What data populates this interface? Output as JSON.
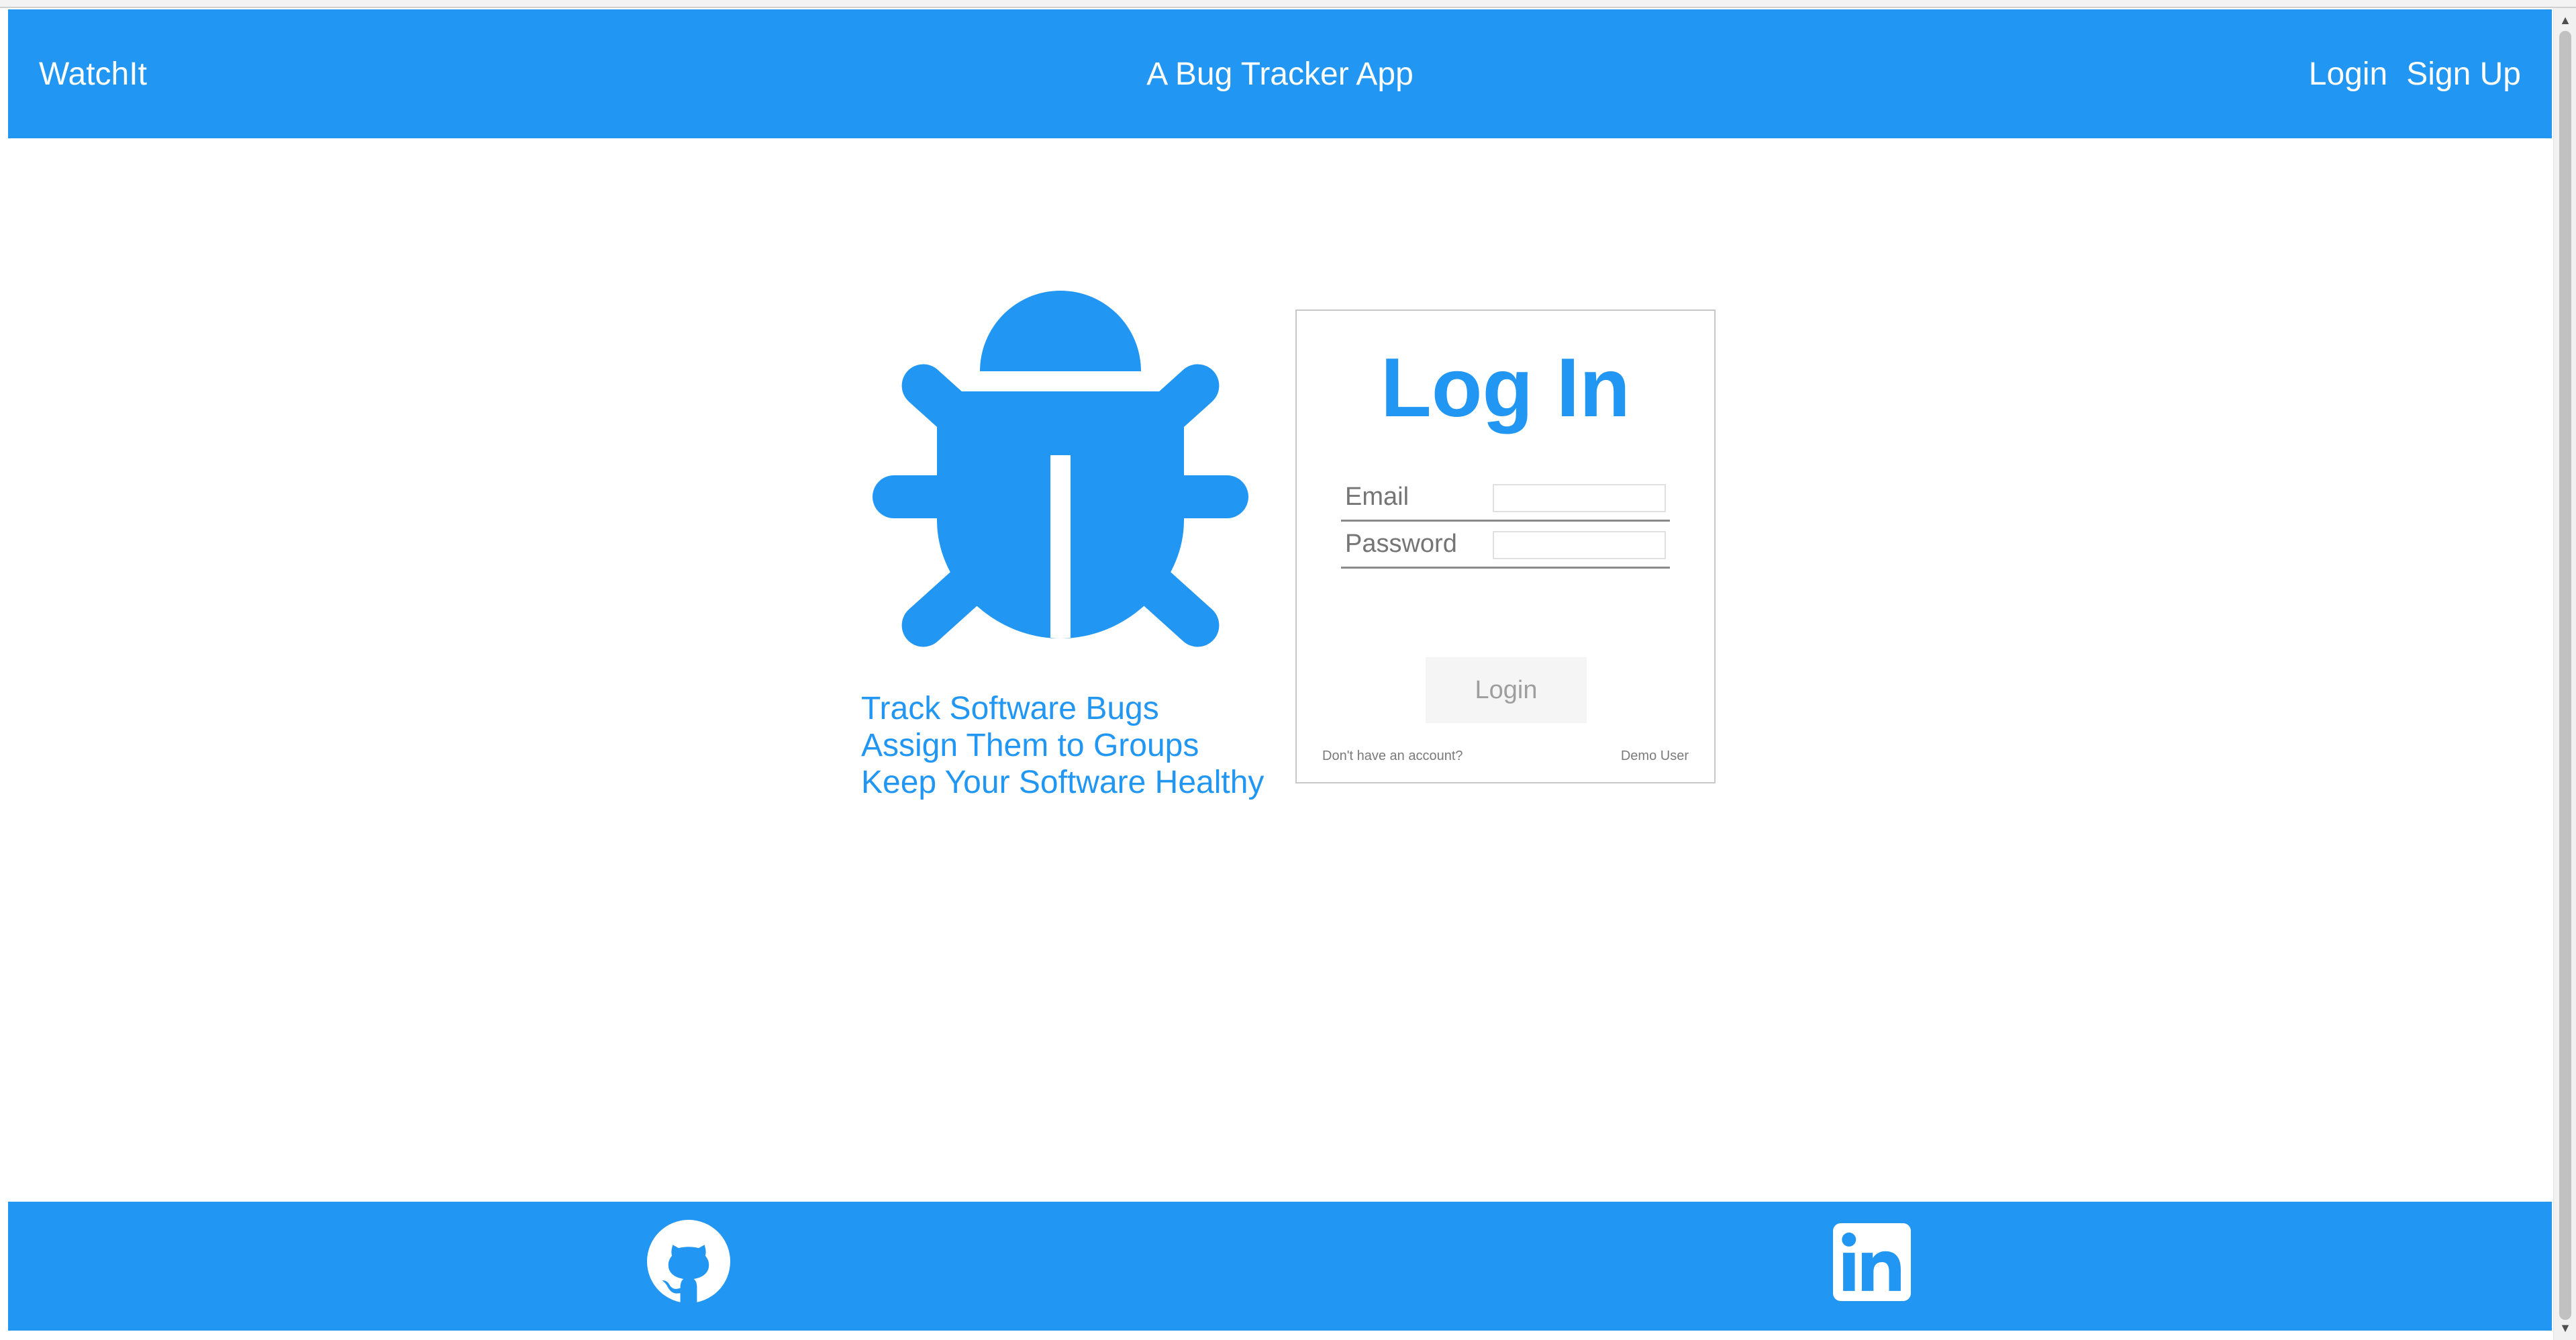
{
  "navbar": {
    "brand": "WatchIt",
    "subtitle": "A Bug Tracker App",
    "links": [
      "Login",
      "Sign Up"
    ]
  },
  "hero": {
    "taglines": [
      "Track Software Bugs",
      "Assign Them to Groups",
      "Keep Your Software Healthy"
    ],
    "icon": "bug-icon"
  },
  "login_form": {
    "title": "Log In",
    "email_label": "Email",
    "email_value": "",
    "password_label": "Password",
    "password_value": "",
    "submit_label": "Login",
    "no_account_text": "Don't have an account?",
    "demo_user_label": "Demo User"
  },
  "footer": {
    "icons": [
      "github-icon",
      "linkedin-icon"
    ]
  },
  "colors": {
    "brand_blue": "#2196f3",
    "white": "#ffffff",
    "button_bg": "#f5f5f5",
    "muted_text": "#757575"
  }
}
